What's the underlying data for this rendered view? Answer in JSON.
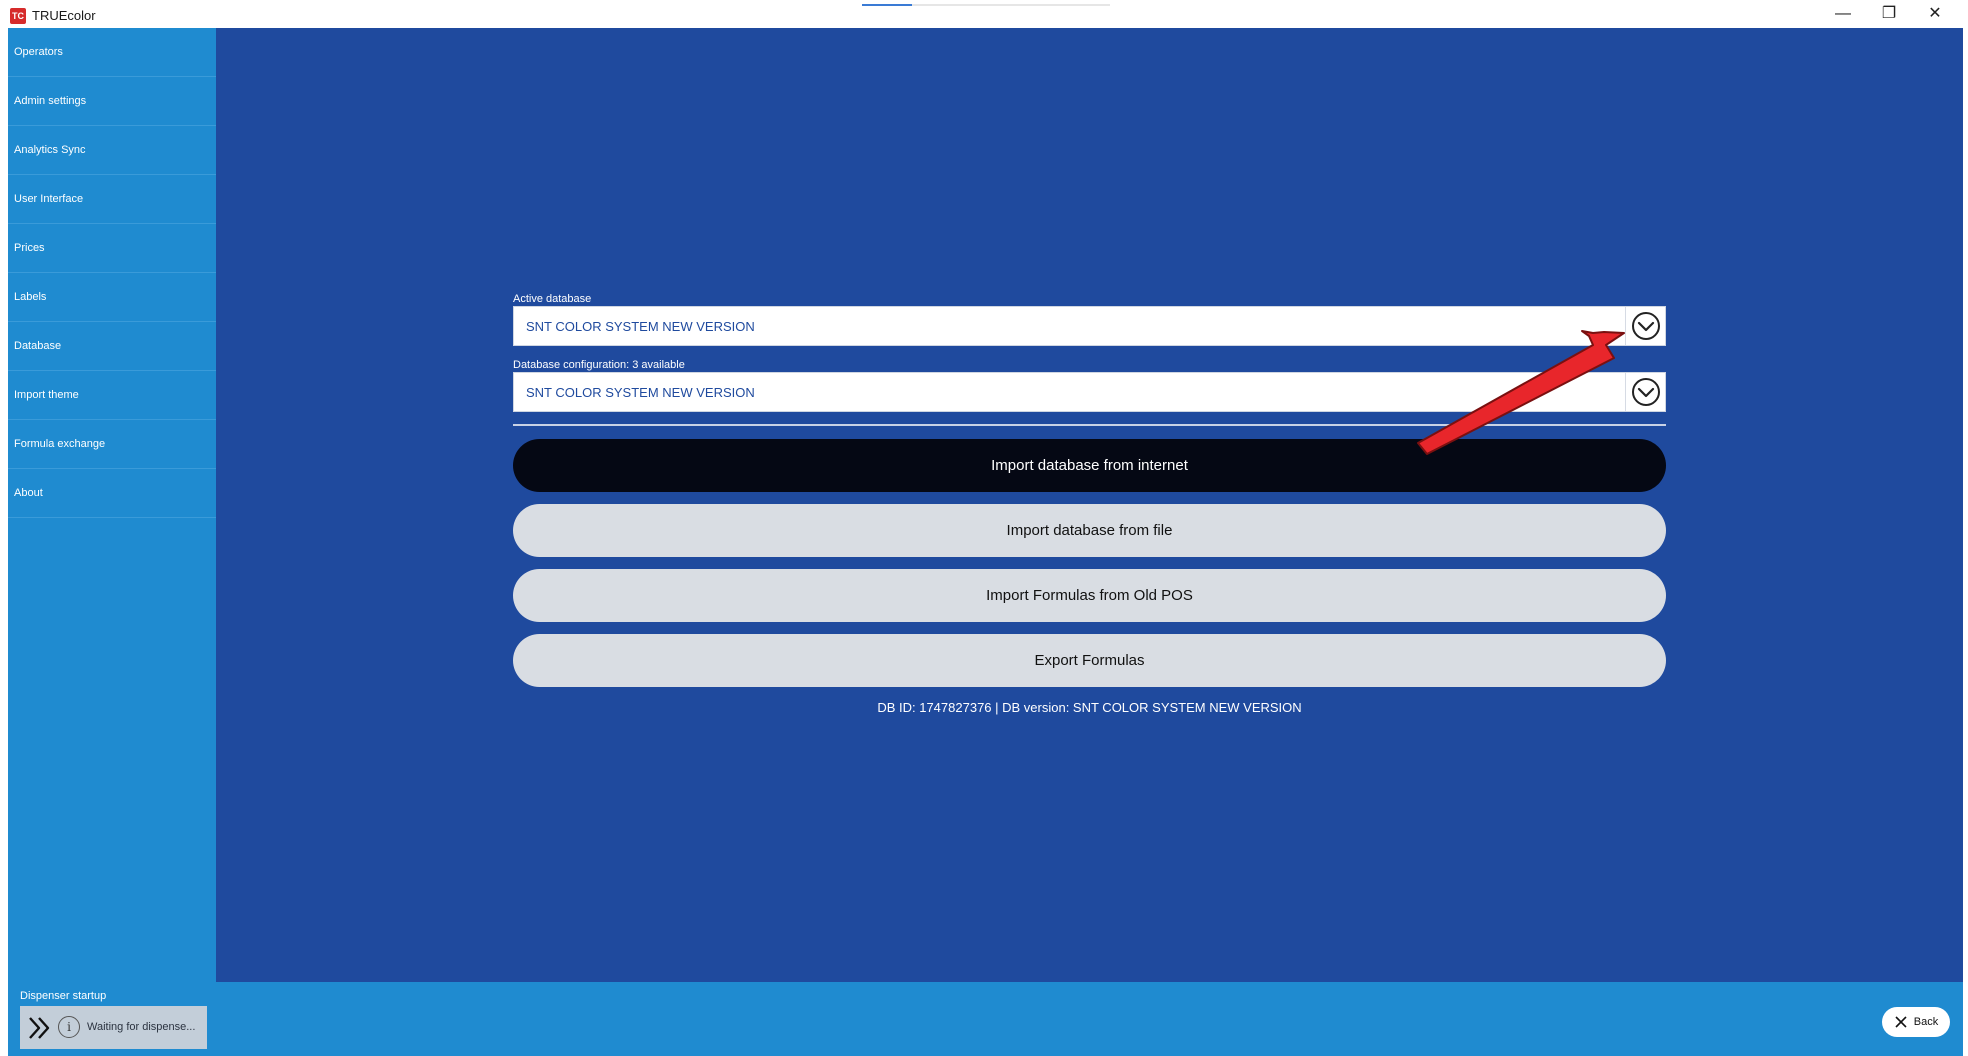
{
  "window": {
    "title": "TRUEcolor",
    "logo_text": "TC",
    "minimize_icon": "—",
    "maximize_icon": "❐",
    "close_icon": "✕"
  },
  "sidebar": {
    "items": [
      {
        "label": "Operators"
      },
      {
        "label": "Admin settings"
      },
      {
        "label": "Analytics Sync"
      },
      {
        "label": "User Interface"
      },
      {
        "label": "Prices"
      },
      {
        "label": "Labels"
      },
      {
        "label": "Database"
      },
      {
        "label": "Import theme"
      },
      {
        "label": "Formula exchange"
      },
      {
        "label": "About"
      }
    ]
  },
  "database": {
    "active_label": "Active database",
    "active_value": "SNT COLOR SYSTEM NEW VERSION",
    "config_label": "Database configuration: 3 available",
    "config_value": "SNT COLOR SYSTEM NEW VERSION"
  },
  "actions": {
    "import_internet": "Import database from internet",
    "import_file": "Import database from file",
    "import_old_pos": "Import Formulas from Old POS",
    "export_formulas": "Export Formulas"
  },
  "db_info": "DB ID: 1747827376 | DB version: SNT COLOR SYSTEM NEW VERSION",
  "status": {
    "title": "Dispenser startup",
    "message": "Waiting for dispense...",
    "info_icon": "i"
  },
  "back_button": {
    "label": "Back"
  },
  "colors": {
    "main_bg": "#1f4a9e",
    "sidebar_bg": "#1f8bd0",
    "primary_button": "#050814",
    "secondary_button": "#d9dde3",
    "annotation_arrow": "#e8262b"
  }
}
